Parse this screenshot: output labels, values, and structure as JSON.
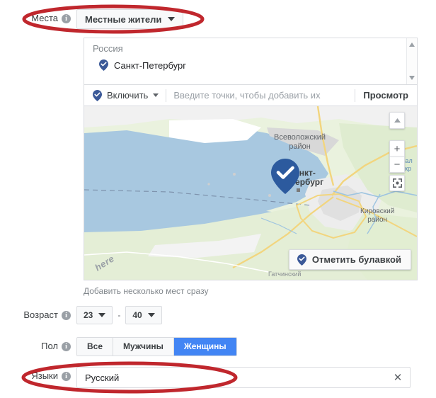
{
  "places": {
    "label": "Места",
    "info_icon": "info-icon",
    "dropdown_value": "Местные жители",
    "caret_icon": "chevron-down-icon"
  },
  "location_panel": {
    "country_header": "Россия",
    "selected_location": "Санкт-Петербург",
    "selected_location_icon": "map-pin-check-icon",
    "scroll_up_icon": "scroll-up-arrow-icon",
    "scroll_down_icon": "scroll-down-arrow-icon",
    "toolbar": {
      "include_label": "Включить",
      "include_icon": "map-pin-check-icon",
      "include_caret_icon": "chevron-down-icon",
      "points_placeholder": "Введите точки, чтобы добавить их",
      "points_value": "",
      "preview_label": "Просмотр"
    }
  },
  "map": {
    "labels": {
      "vsevolozhsky": "Всеволожский",
      "vsevolozhsky_line2": "район",
      "spb": "Санкт-",
      "spb_line2": "Петербург",
      "kirovsky": "Кировский",
      "kirovsky_line2": "район",
      "zaliv": "Зал",
      "zaliv_line2": "окр",
      "gatchina": "Гатчинский",
      "attribution": "here"
    },
    "marker_icon": "map-marker-check-icon",
    "controls": {
      "compass_icon": "compass-up-icon",
      "zoom_in_label": "+",
      "zoom_out_label": "−",
      "fullscreen_icon": "fullscreen-icon"
    },
    "pin_button": {
      "label": "Отметить булавкой",
      "icon": "map-pin-check-icon"
    }
  },
  "bulk_link": "Добавить несколько мест сразу",
  "age": {
    "label": "Возраст",
    "info_icon": "info-icon",
    "min_value": "23",
    "max_value": "40",
    "separator": "-",
    "caret_icon": "chevron-down-icon"
  },
  "gender": {
    "label": "Пол",
    "info_icon": "info-icon",
    "options": [
      {
        "label": "Все",
        "selected": false
      },
      {
        "label": "Мужчины",
        "selected": false
      },
      {
        "label": "Женщины",
        "selected": true
      }
    ]
  },
  "languages": {
    "label": "Языки",
    "info_icon": "info-icon",
    "value": "Русский",
    "placeholder": "",
    "clear_icon": "close-icon"
  },
  "annotations": [
    {
      "name": "places-ellipse",
      "color": "#c0272d"
    },
    {
      "name": "languages-ellipse",
      "color": "#c0272d"
    }
  ],
  "colors": {
    "accent_blue": "#4285f4",
    "pin_blue": "#3b5998",
    "annotation_red": "#c0272d",
    "border_gray": "#dadce0",
    "map_water": "#a8c8e0",
    "map_land": "#e8f0d8"
  }
}
